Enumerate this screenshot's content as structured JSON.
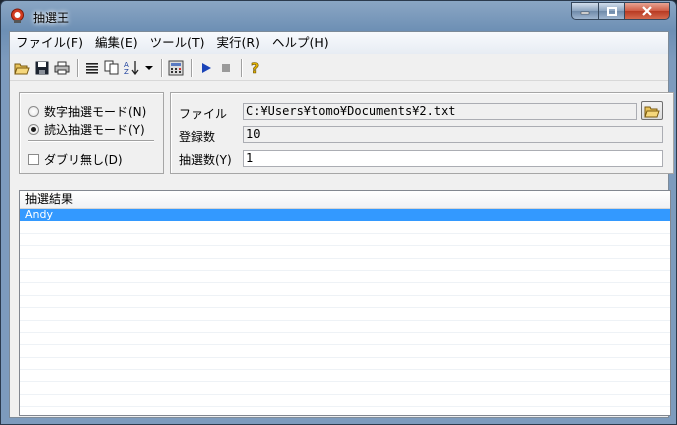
{
  "window": {
    "title": "抽選王",
    "icon": "app-ball-icon"
  },
  "menu": {
    "items": [
      {
        "label": "ファイル(F)"
      },
      {
        "label": "編集(E)"
      },
      {
        "label": "ツール(T)"
      },
      {
        "label": "実行(R)"
      },
      {
        "label": "ヘルプ(H)"
      }
    ]
  },
  "toolbar": {
    "buttons": [
      "open-folder-icon",
      "save-icon",
      "print-icon",
      "list-icon",
      "copy-icon",
      "sort-az-icon",
      "dropdown-arrow-icon",
      "calculator-icon",
      "play-icon",
      "stop-icon",
      "help-icon"
    ]
  },
  "mode": {
    "number_mode_label": "数字抽選モード(N)",
    "read_mode_label": "読込抽選モード(Y)",
    "selected": "read",
    "no_duplicate_label": "ダブリ無し(D)",
    "no_duplicate_checked": false
  },
  "file": {
    "file_label": "ファイル",
    "file_path": "C:¥Users¥tomo¥Documents¥2.txt",
    "count_label": "登録数",
    "count_value": "10",
    "draw_label": "抽選数(Y)",
    "draw_value": "1"
  },
  "results": {
    "header": "抽選結果",
    "rows": [
      "Andy"
    ],
    "selected_index": 0
  },
  "colors": {
    "selection": "#3399ff",
    "client_bg": "#f0f0f0"
  }
}
